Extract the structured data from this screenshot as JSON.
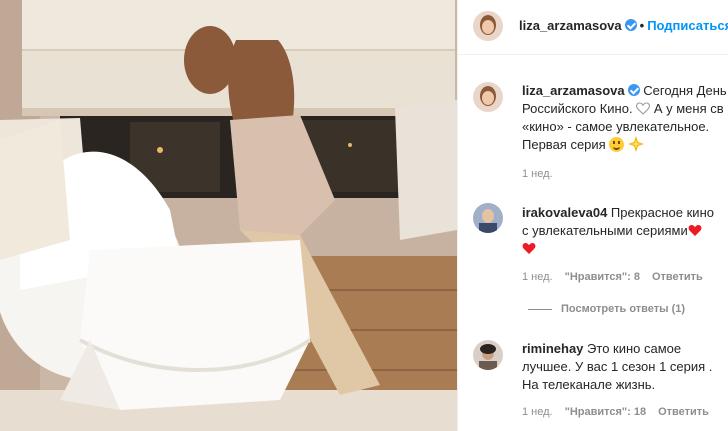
{
  "post": {
    "author": "liza_arzamasova",
    "follow_label": "Подписаться",
    "separator": "•"
  },
  "caption": {
    "author": "liza_arzamasova",
    "text_1": "Сегодня День",
    "text_2": "Российского Кино.",
    "text_3": "А у меня св",
    "text_4": "«кино» - самое увлекательное.",
    "text_5": "Первая серия",
    "time": "1 нед."
  },
  "comments": [
    {
      "author": "irakovaleva04",
      "text_1": "Прекрасное кино",
      "text_2": "с увлекательными сериями",
      "time": "1 нед.",
      "likes": "\"Нравится\": 8",
      "reply": "Ответить",
      "view_replies": "Посмотреть ответы (1)"
    },
    {
      "author": "riminehay",
      "text_1": "Это кино самое",
      "text_2": "лучшее. У вас 1 сезон 1 серия .",
      "text_3": "На телеканале жизнь.",
      "time": "1 нед.",
      "likes": "\"Нравится\": 18",
      "reply": "Ответить"
    }
  ],
  "colors": {
    "link_blue": "#0095f6",
    "heart_red": "#ed1c24",
    "verified": "#3897f0"
  },
  "icons": [
    "verified-badge-icon",
    "heart-emoji-icon",
    "smile-emoji-icon",
    "sparkle-emoji-icon"
  ]
}
